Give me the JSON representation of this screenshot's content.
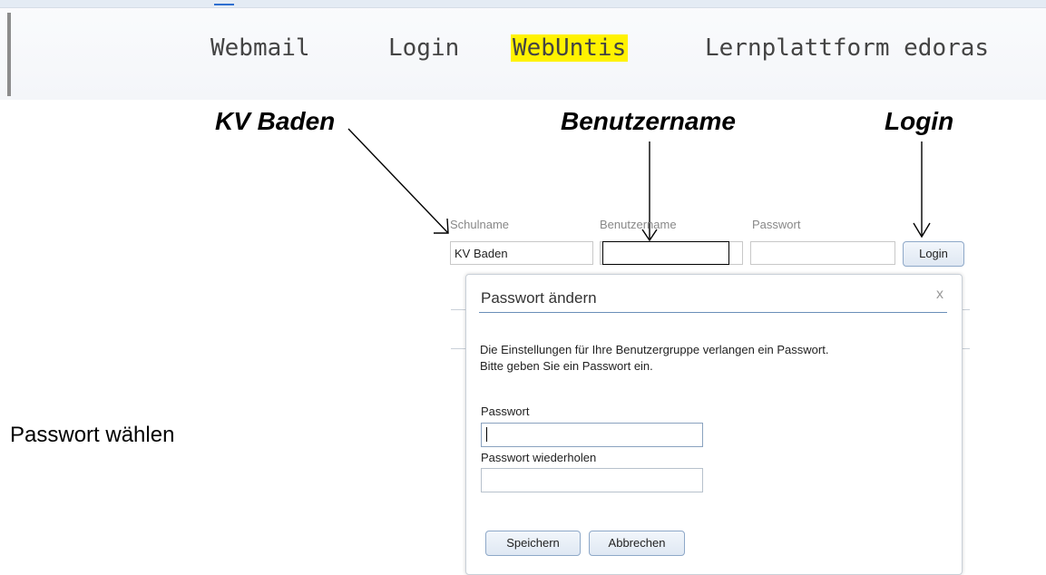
{
  "nav": {
    "items": [
      "Webmail",
      "Login",
      "WebUntis",
      "Lernplattform edoras"
    ],
    "highlight_color": "#fff200"
  },
  "annotations": {
    "school": "KV Baden",
    "username": "Benutzername",
    "login": "Login",
    "side_note": "Passwort wählen"
  },
  "login_form": {
    "school_label": "Schulname",
    "school_value": "KV Baden",
    "username_label": "Benutzername",
    "username_value": "",
    "password_label": "Passwort",
    "password_value": "",
    "login_button": "Login"
  },
  "dialog": {
    "title": "Passwort ändern",
    "close_icon": "close-icon",
    "close_glyph": "x",
    "message_line1": "Die Einstellungen für Ihre Benutzergruppe verlangen ein Passwort.",
    "message_line2": "Bitte geben Sie ein Passwort ein.",
    "password_label": "Passwort",
    "password_value": "",
    "repeat_label": "Passwort wiederholen",
    "repeat_value": "",
    "save_button": "Speichern",
    "cancel_button": "Abbrechen"
  },
  "colors": {
    "accent_rule": "#6a8fb8",
    "button_border": "#8ea8c8"
  }
}
